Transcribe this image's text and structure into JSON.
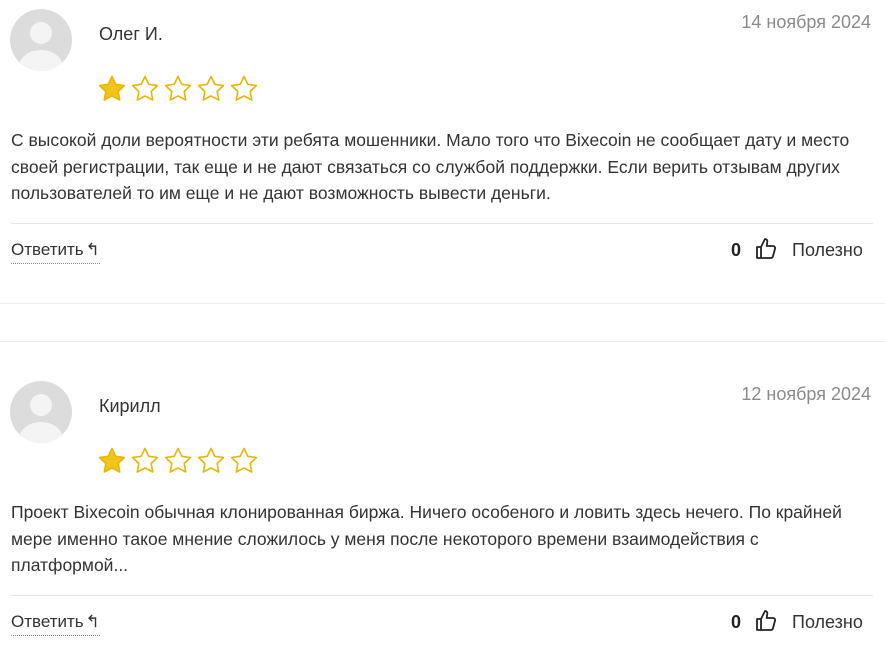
{
  "reviews": [
    {
      "author": "Олег И.",
      "date": "14 ноября 2024",
      "rating": 1,
      "rating_max": 5,
      "text": "С высокой доли вероятности эти ребята мошенники. Мало того что Bixecoin не сообщает дату и место своей регистрации, так еще и не дают связаться со службой поддержки. Если верить отзывам других пользователей то им еще и не дают возможность вывести деньги.",
      "reply_label": "Ответить",
      "reply_arrow": "↰",
      "helpful_count": "0",
      "helpful_label": "Полезно"
    },
    {
      "author": "Кирилл",
      "date": "12 ноября 2024",
      "rating": 1,
      "rating_max": 5,
      "text": "Проект Bixecoin обычная клонированная биржа. Ничего особеного и ловить здесь нечего. По крайней мере именно такое мнение сложилось у меня после некоторого времени взаимодействия с платформой...",
      "reply_label": "Ответить",
      "reply_arrow": "↰",
      "helpful_count": "0",
      "helpful_label": "Полезно"
    }
  ],
  "colors": {
    "star": "#F0C419",
    "star_outline": "#E8B600",
    "avatar_bg": "#dcdcdc",
    "avatar_fg": "#f4f4f4"
  },
  "icons": {
    "avatar": "user-silhouette-icon",
    "star": "star-icon",
    "reply": "reply-arrow-icon",
    "helpful": "thumbs-up-icon"
  }
}
